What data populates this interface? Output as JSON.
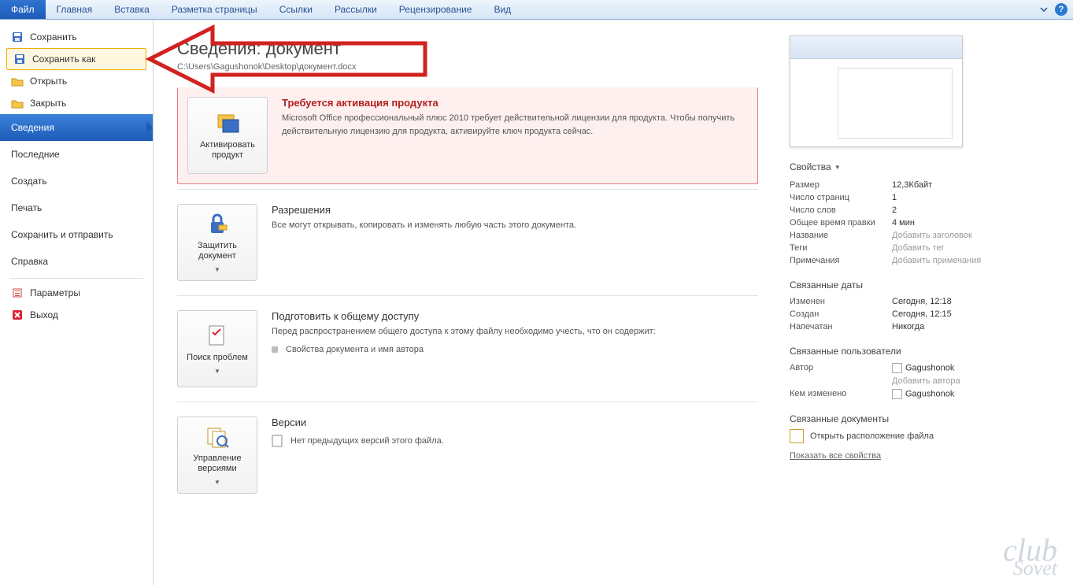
{
  "ribbon": {
    "tabs": [
      "Файл",
      "Главная",
      "Вставка",
      "Разметка страницы",
      "Ссылки",
      "Рассылки",
      "Рецензирование",
      "Вид"
    ],
    "active": 0
  },
  "sidebar": {
    "top_items": [
      {
        "label": "Сохранить",
        "icon": "save"
      },
      {
        "label": "Сохранить как",
        "icon": "save-as",
        "highlight": true
      },
      {
        "label": "Открыть",
        "icon": "open"
      },
      {
        "label": "Закрыть",
        "icon": "close"
      }
    ],
    "tabs": [
      {
        "label": "Сведения",
        "active": true
      },
      {
        "label": "Последние"
      },
      {
        "label": "Создать"
      },
      {
        "label": "Печать"
      },
      {
        "label": "Сохранить и отправить"
      },
      {
        "label": "Справка"
      }
    ],
    "bottom_items": [
      {
        "label": "Параметры",
        "icon": "options"
      },
      {
        "label": "Выход",
        "icon": "exit"
      }
    ]
  },
  "info": {
    "heading": "Сведения: документ",
    "path": "C:\\Users\\Gagushonok\\Desktop\\документ.docx",
    "activation": {
      "button": "Активировать продукт",
      "title": "Требуется активация продукта",
      "text": "Microsoft Office профессиональный плюс 2010 требует действительной лицензии для продукта. Чтобы получить действительную лицензию для продукта, активируйте ключ продукта сейчас."
    },
    "permissions": {
      "button": "Защитить документ",
      "title": "Разрешения",
      "text": "Все могут открывать, копировать и изменять любую часть этого документа."
    },
    "prepare": {
      "button": "Поиск проблем",
      "title": "Подготовить к общему доступу",
      "text": "Перед распространением общего доступа к этому файлу необходимо учесть, что он содержит:",
      "bullet": "Свойства документа и имя автора"
    },
    "versions": {
      "button": "Управление версиями",
      "title": "Версии",
      "text": "Нет предыдущих версий этого файла."
    }
  },
  "props": {
    "heading": "Свойства",
    "rows": [
      {
        "k": "Размер",
        "v": "12,3Кбайт"
      },
      {
        "k": "Число страниц",
        "v": "1"
      },
      {
        "k": "Число слов",
        "v": "2"
      },
      {
        "k": "Общее время правки",
        "v": "4 мин"
      },
      {
        "k": "Название",
        "v": "Добавить заголовок",
        "ph": true
      },
      {
        "k": "Теги",
        "v": "Добавить тег",
        "ph": true
      },
      {
        "k": "Примечания",
        "v": "Добавить примечания",
        "ph": true
      }
    ],
    "dates_heading": "Связанные даты",
    "dates": [
      {
        "k": "Изменен",
        "v": "Сегодня, 12:18"
      },
      {
        "k": "Создан",
        "v": "Сегодня, 12:15"
      },
      {
        "k": "Напечатан",
        "v": "Никогда"
      }
    ],
    "people_heading": "Связанные пользователи",
    "author_label": "Автор",
    "author": "Gagushonok",
    "add_author": "Добавить автора",
    "modified_by_label": "Кем изменено",
    "modified_by": "Gagushonok",
    "docs_heading": "Связанные документы",
    "open_location": "Открыть расположение файла",
    "show_all": "Показать все свойства"
  },
  "watermark": {
    "top": "club",
    "bottom": "Sovet"
  }
}
